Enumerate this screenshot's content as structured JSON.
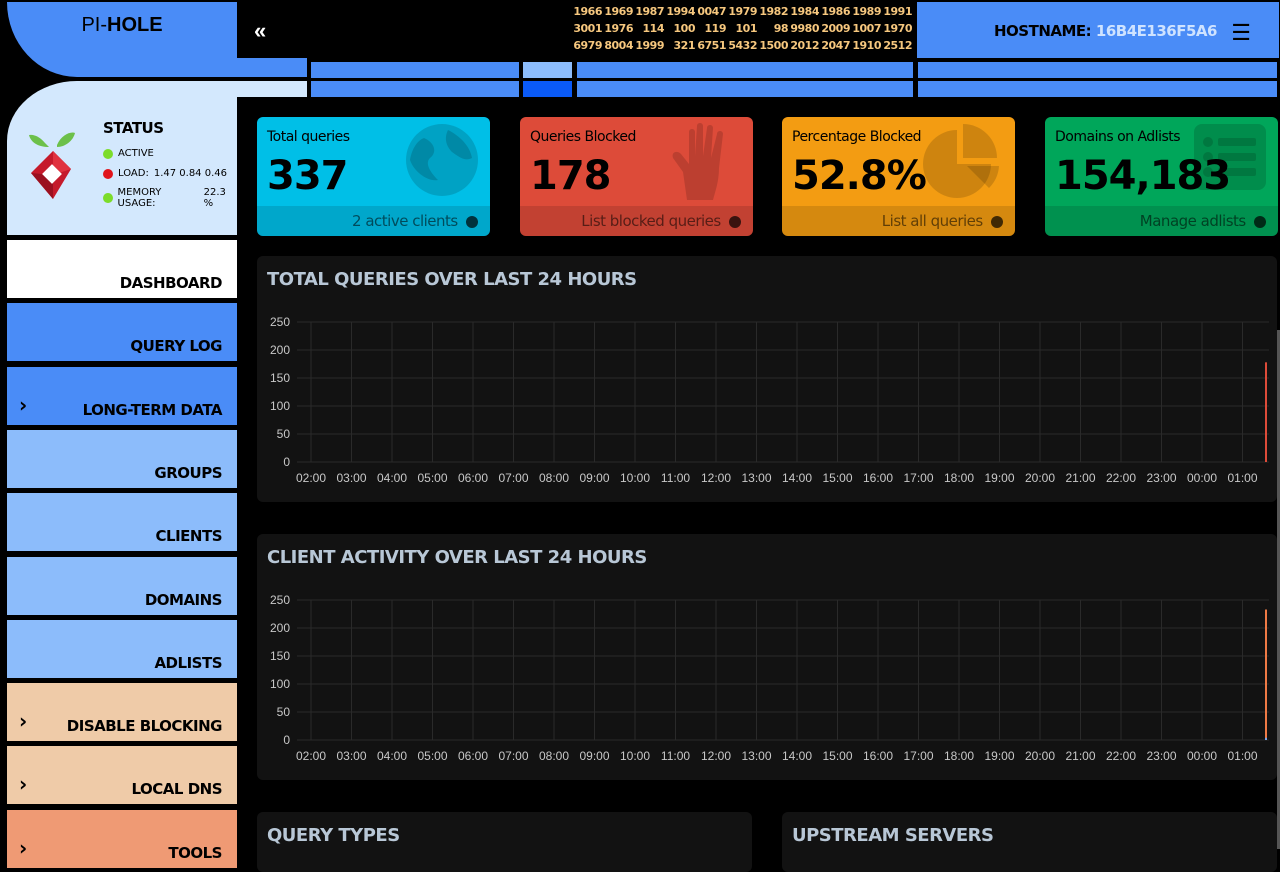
{
  "logo": {
    "prefix": "PI-",
    "bold": "HOLE"
  },
  "topbar": {
    "collapse_icon": "double-chevron-left-icon",
    "counters": [
      [
        "1966",
        "1969",
        "1987",
        "1994",
        "0047",
        "1979",
        "1982",
        "1984",
        "1986",
        "1989",
        "1991"
      ],
      [
        "3001",
        "1976",
        "114",
        "100",
        "119",
        "101",
        "98",
        "9980",
        "2009",
        "1007",
        "1970"
      ],
      [
        "6979",
        "8004",
        "1999",
        "321",
        "6751",
        "5432",
        "1500",
        "2012",
        "2047",
        "1910",
        "2512"
      ]
    ],
    "hostname_label": "HOSTNAME:",
    "hostname_value": "16B4E136F5A6",
    "menu_icon": "hamburger-icon"
  },
  "status": {
    "title": "STATUS",
    "active": "ACTIVE",
    "load_label": "LOAD:",
    "load_value": "1.47  0.84  0.46",
    "memory_label": "MEMORY USAGE:",
    "memory_value": "22.3 %",
    "colors": {
      "active": "#7cdc2a",
      "load": "#e0141c",
      "memory": "#7cdc2a"
    }
  },
  "sidebar": {
    "items": [
      {
        "label": "DASHBOARD",
        "chevron": false,
        "color": "#ffffff"
      },
      {
        "label": "QUERY LOG",
        "chevron": false,
        "color": "#4a8cf7"
      },
      {
        "label": "LONG-TERM DATA",
        "chevron": true,
        "color": "#4a8cf7"
      },
      {
        "label": "GROUPS",
        "chevron": false,
        "color": "#8cbcfb"
      },
      {
        "label": "CLIENTS",
        "chevron": false,
        "color": "#8cbcfb"
      },
      {
        "label": "DOMAINS",
        "chevron": false,
        "color": "#8cbcfb"
      },
      {
        "label": "ADLISTS",
        "chevron": false,
        "color": "#8cbcfb"
      },
      {
        "label": "DISABLE BLOCKING",
        "chevron": true,
        "color": "#efcba8"
      },
      {
        "label": "LOCAL DNS",
        "chevron": true,
        "color": "#efcba8"
      },
      {
        "label": "TOOLS",
        "chevron": true,
        "color": "#ef9a74"
      }
    ]
  },
  "cards": [
    {
      "title": "Total queries",
      "value": "337",
      "footer": "2 active clients",
      "icon": "globe-icon",
      "color": "#00bfe7"
    },
    {
      "title": "Queries Blocked",
      "value": "178",
      "footer": "List blocked queries",
      "icon": "hand-icon",
      "color": "#dd4b39"
    },
    {
      "title": "Percentage Blocked",
      "value": "52.8%",
      "footer": "List all queries",
      "icon": "pie-chart-icon",
      "color": "#f39c12"
    },
    {
      "title": "Domains on Adlists",
      "value": "154,183",
      "footer": "Manage adlists",
      "icon": "list-icon",
      "color": "#00a65a"
    }
  ],
  "panels": {
    "total_queries_title": "TOTAL QUERIES OVER LAST 24 HOURS",
    "client_activity_title": "CLIENT ACTIVITY OVER LAST 24 HOURS",
    "query_types_title": "QUERY TYPES",
    "upstream_title": "UPSTREAM SERVERS"
  },
  "chart_data": [
    {
      "type": "bar",
      "title": "TOTAL QUERIES OVER LAST 24 HOURS",
      "categories": [
        "02:00",
        "03:00",
        "04:00",
        "05:00",
        "06:00",
        "07:00",
        "08:00",
        "09:00",
        "10:00",
        "11:00",
        "12:00",
        "13:00",
        "14:00",
        "15:00",
        "16:00",
        "17:00",
        "18:00",
        "19:00",
        "20:00",
        "21:00",
        "22:00",
        "23:00",
        "00:00",
        "01:00",
        "02:00"
      ],
      "series": [
        {
          "values": [
            0,
            0,
            0,
            0,
            0,
            0,
            0,
            0,
            0,
            0,
            0,
            0,
            0,
            0,
            0,
            0,
            0,
            0,
            0,
            0,
            0,
            0,
            0,
            0,
            159
          ],
          "color": "#00a65a"
        },
        {
          "values": [
            0,
            0,
            0,
            0,
            0,
            0,
            0,
            0,
            0,
            0,
            0,
            0,
            0,
            0,
            0,
            0,
            0,
            0,
            0,
            0,
            0,
            0,
            0,
            0,
            178
          ],
          "color": "#dd4b39"
        }
      ],
      "ylim": [
        0,
        250
      ],
      "yticks": [
        0,
        50,
        100,
        150,
        200,
        250
      ],
      "grid": true,
      "xlabel": "",
      "ylabel": ""
    },
    {
      "type": "bar",
      "title": "CLIENT ACTIVITY OVER LAST 24 HOURS",
      "categories": [
        "02:00",
        "03:00",
        "04:00",
        "05:00",
        "06:00",
        "07:00",
        "08:00",
        "09:00",
        "10:00",
        "11:00",
        "12:00",
        "13:00",
        "14:00",
        "15:00",
        "16:00",
        "17:00",
        "18:00",
        "19:00",
        "20:00",
        "21:00",
        "22:00",
        "23:00",
        "00:00",
        "01:00",
        "02:00"
      ],
      "series": [
        {
          "values": [
            0,
            0,
            0,
            0,
            0,
            0,
            0,
            0,
            0,
            0,
            0,
            0,
            0,
            0,
            0,
            0,
            0,
            0,
            0,
            0,
            0,
            0,
            0,
            0,
            233
          ],
          "color": "#ef7a45"
        },
        {
          "values": [
            0,
            0,
            0,
            0,
            0,
            0,
            0,
            0,
            0,
            0,
            0,
            0,
            0,
            0,
            0,
            0,
            0,
            0,
            0,
            0,
            0,
            0,
            0,
            0,
            4
          ],
          "color": "#7aa7ef"
        }
      ],
      "ylim": [
        0,
        250
      ],
      "yticks": [
        0,
        50,
        100,
        150,
        200,
        250
      ],
      "grid": true,
      "xlabel": "",
      "ylabel": ""
    }
  ]
}
